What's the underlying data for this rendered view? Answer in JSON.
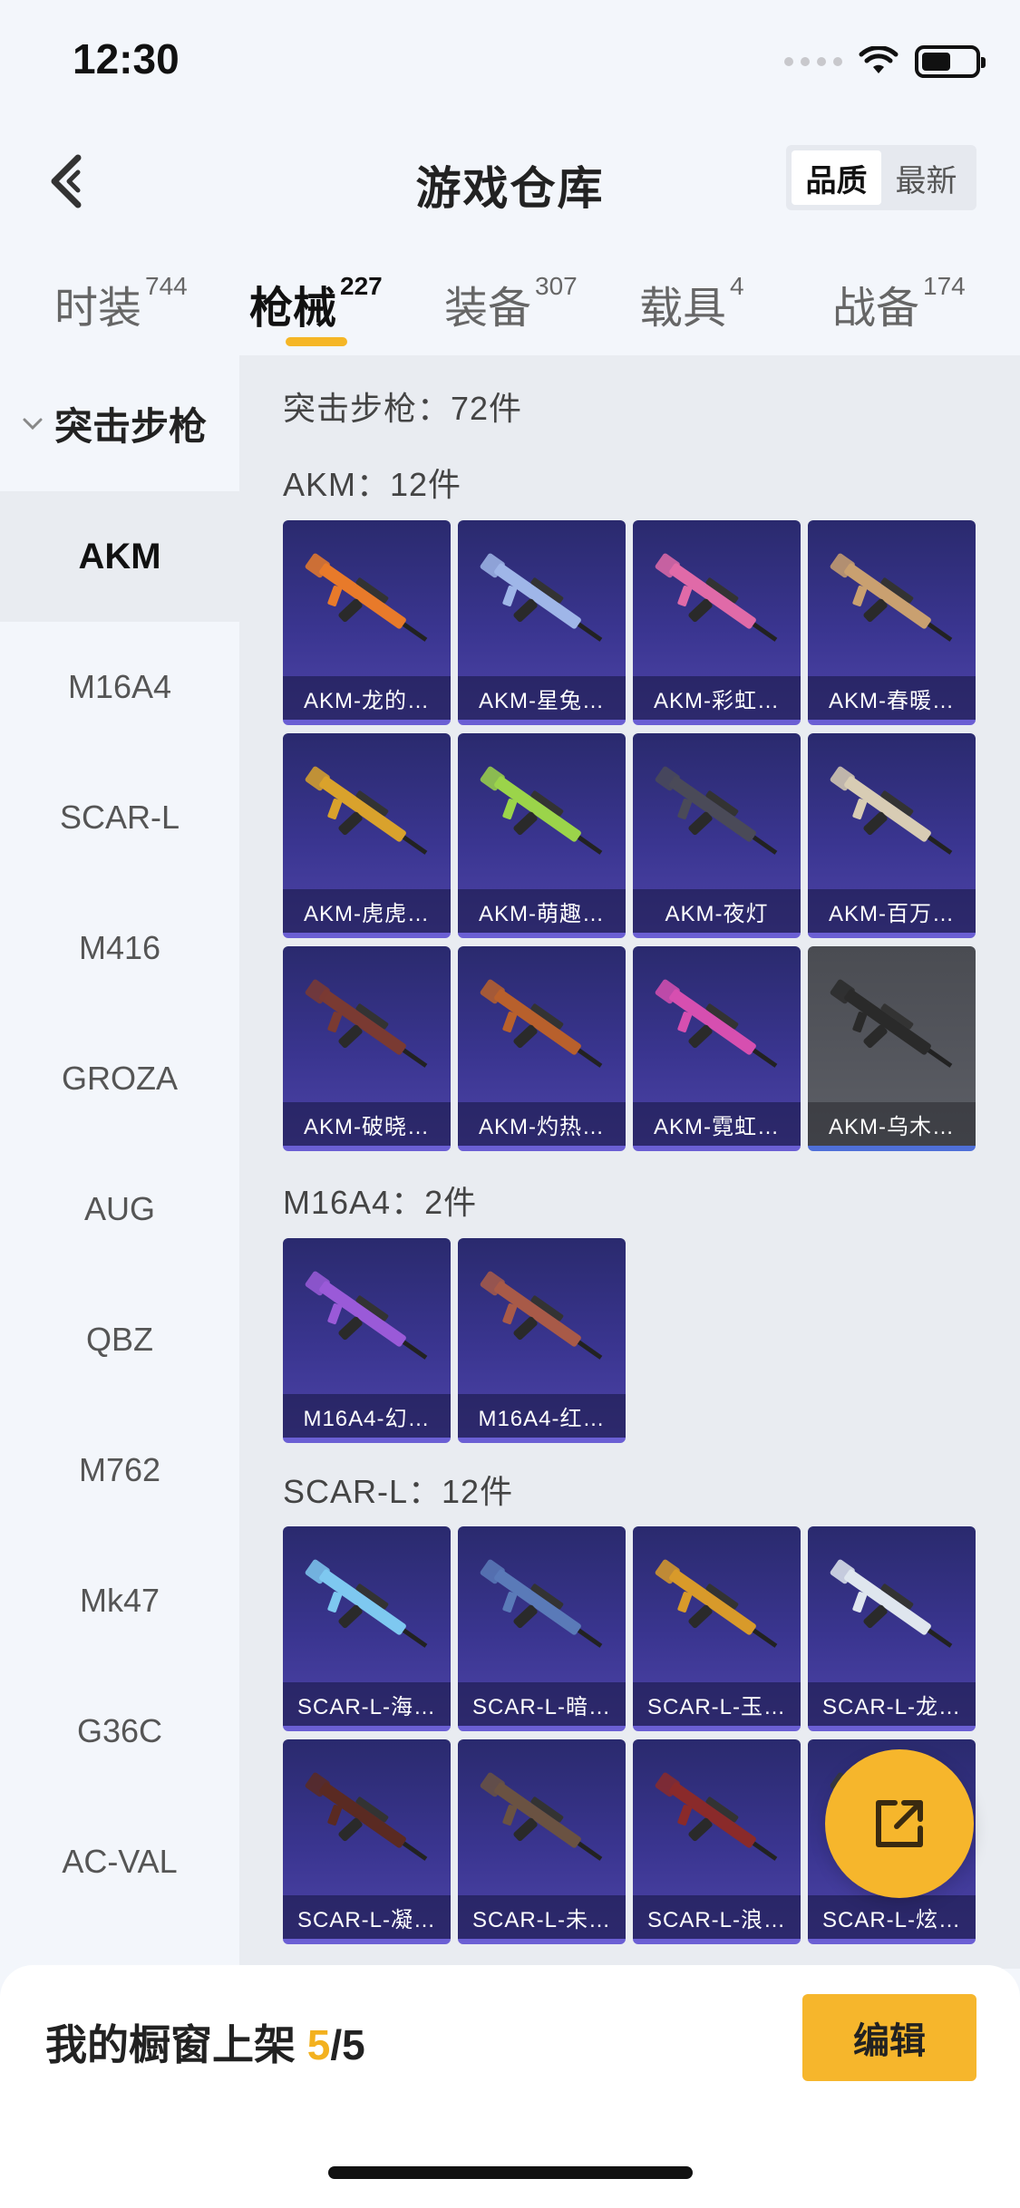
{
  "status_bar": {
    "time": "12:30"
  },
  "header": {
    "title": "游戏仓库",
    "sort_options": [
      "品质",
      "最新"
    ],
    "active_sort": "品质"
  },
  "tabs": [
    {
      "label": "时装",
      "count": "744"
    },
    {
      "label": "枪械",
      "count": "227"
    },
    {
      "label": "装备",
      "count": "307"
    },
    {
      "label": "载具",
      "count": "4"
    },
    {
      "label": "战备",
      "count": "174"
    }
  ],
  "active_tab": "枪械",
  "sidebar": {
    "group_label": "突击步枪",
    "items": [
      "AKM",
      "M16A4",
      "SCAR-L",
      "M416",
      "GROZA",
      "AUG",
      "QBZ",
      "M762",
      "Mk47",
      "G36C",
      "AC-VAL"
    ],
    "active_item": "AKM"
  },
  "main": {
    "category_summary": "突击步枪：72件",
    "sections": [
      {
        "title": "AKM：12件",
        "items": [
          {
            "label": "AKM-龙的…",
            "accent": "#e87a2a"
          },
          {
            "label": "AKM-星兔…",
            "accent": "#9fb6e8"
          },
          {
            "label": "AKM-彩虹…",
            "accent": "#e06aa8"
          },
          {
            "label": "AKM-春暖…",
            "accent": "#c9a070"
          },
          {
            "label": "AKM-虎虎…",
            "accent": "#d9a22c"
          },
          {
            "label": "AKM-萌趣…",
            "accent": "#9bd44a"
          },
          {
            "label": "AKM-夜灯",
            "accent": "#4a4a58"
          },
          {
            "label": "AKM-百万…",
            "accent": "#d8ccb4"
          },
          {
            "label": "AKM-破晓…",
            "accent": "#7a3a32"
          },
          {
            "label": "AKM-灼热…",
            "accent": "#b8602c"
          },
          {
            "label": "AKM-霓虹…",
            "accent": "#d64fb0"
          },
          {
            "label": "AKM-乌木…",
            "accent": "#2a2a2a",
            "gray": true
          }
        ]
      },
      {
        "title": "M16A4：2件",
        "items": [
          {
            "label": "M16A4-幻…",
            "accent": "#9a5ad8"
          },
          {
            "label": "M16A4-红…",
            "accent": "#a85a48"
          }
        ]
      },
      {
        "title": "SCAR-L：12件",
        "items": [
          {
            "label": "SCAR-L-海…",
            "accent": "#7ec8f0"
          },
          {
            "label": "SCAR-L-暗…",
            "accent": "#5a7ab8"
          },
          {
            "label": "SCAR-L-玉…",
            "accent": "#d89a2a"
          },
          {
            "label": "SCAR-L-龙…",
            "accent": "#dfe6ee"
          },
          {
            "label": "SCAR-L-凝…",
            "accent": "#5a2a22"
          },
          {
            "label": "SCAR-L-未…",
            "accent": "#6a5242"
          },
          {
            "label": "SCAR-L-浪…",
            "accent": "#8a2a2a"
          },
          {
            "label": "SCAR-L-炫…",
            "accent": "#3a3a3a"
          }
        ]
      }
    ]
  },
  "bottom_bar": {
    "showcase_label": "我的橱窗上架",
    "showcase_current": "5",
    "showcase_total": "/5",
    "edit_label": "编辑"
  },
  "colors": {
    "accent": "#f6b62c",
    "card_bg": "#3a3590"
  }
}
